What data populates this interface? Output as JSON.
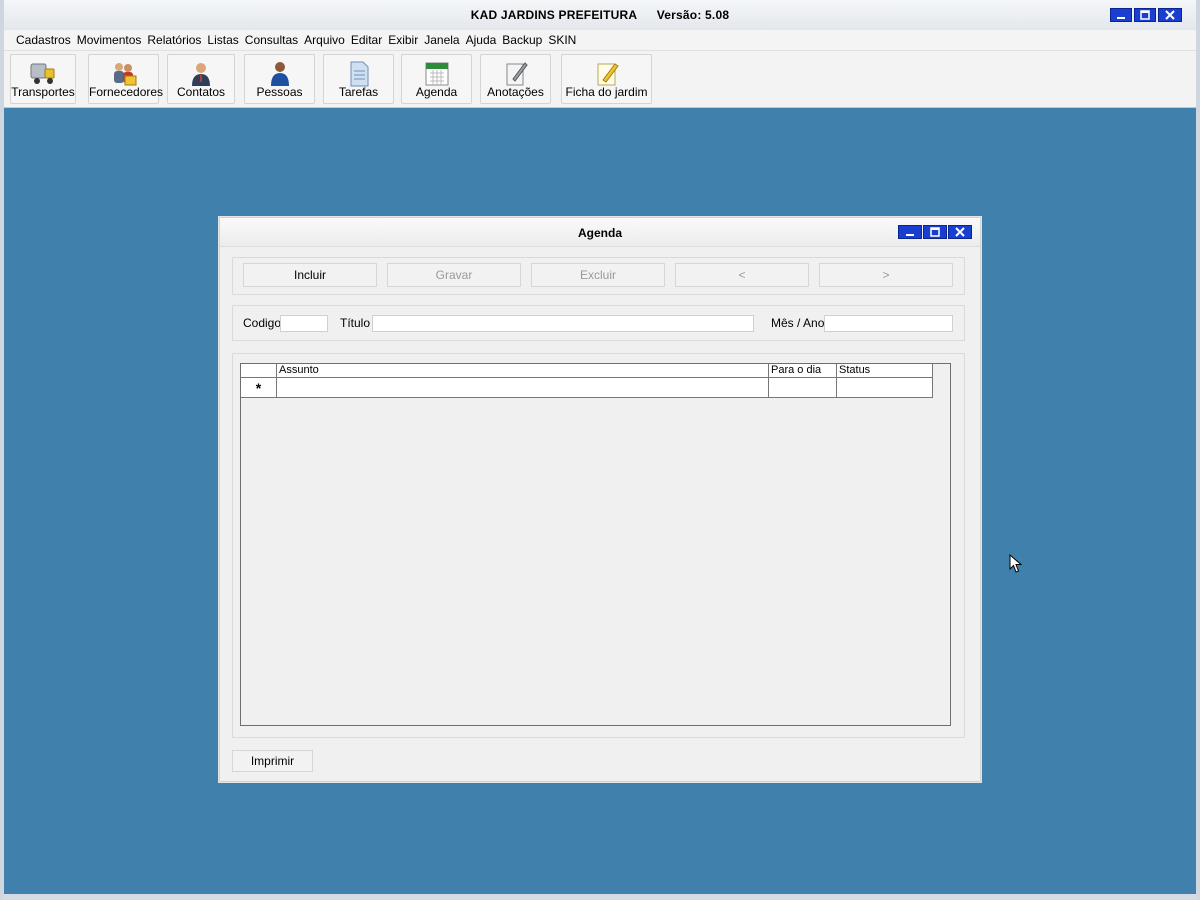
{
  "window": {
    "app_name": "KAD JARDINS PREFEITURA",
    "version": "Versão: 5.08",
    "controls": {
      "minimize": "_",
      "maximize": "□",
      "close": "X"
    }
  },
  "menu": [
    "Cadastros",
    "Movimentos",
    "Relatórios",
    "Listas",
    "Consultas",
    "Arquivo",
    "Editar",
    "Exibir",
    "Janela",
    "Ajuda",
    "Backup",
    "SKIN"
  ],
  "toolbar": [
    {
      "label": "Transportes",
      "icon": "truck-icon"
    },
    {
      "label": "Fornecedores",
      "icon": "suppliers-icon"
    },
    {
      "label": "Contatos",
      "icon": "contact-person-icon"
    },
    {
      "label": "Pessoas",
      "icon": "person-icon"
    },
    {
      "label": "Tarefas",
      "icon": "document-icon"
    },
    {
      "label": "Agenda",
      "icon": "calendar-icon"
    },
    {
      "label": "Anotações",
      "icon": "notepad-icon"
    },
    {
      "label": "Ficha do jardim",
      "icon": "pencil-paper-icon"
    }
  ],
  "dialog": {
    "title": "Agenda",
    "controls": {
      "minimize": "_",
      "maximize": "□",
      "close": "X"
    },
    "actions": {
      "incluir": "Incluir",
      "gravar": "Gravar",
      "excluir": "Excluir",
      "prev": "<",
      "next": ">"
    },
    "fields": {
      "codigo_label": "Codigo",
      "codigo_value": "",
      "titulo_label": "Título",
      "titulo_value": "",
      "mes_ano_label": "Mês / Ano",
      "mes_ano_value": ""
    },
    "grid": {
      "columns": [
        "Assunto",
        "Para o dia",
        "Status"
      ],
      "new_row_marker": "*",
      "rows": []
    },
    "print_button": "Imprimir"
  },
  "colors": {
    "desktop": "#3f80ad",
    "window_button": "#1a3fd0"
  }
}
